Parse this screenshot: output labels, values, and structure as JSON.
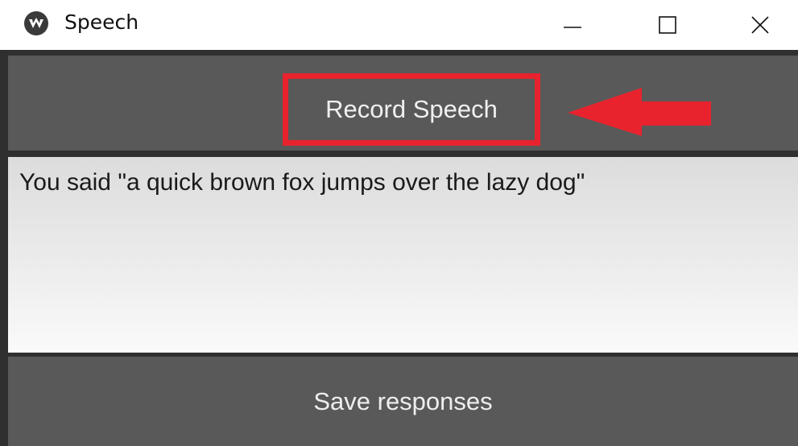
{
  "window": {
    "title": "Speech",
    "icon": "kivy-app-icon",
    "controls": {
      "minimize": "minimize-icon",
      "maximize": "maximize-icon",
      "close": "close-icon"
    }
  },
  "main": {
    "record_button_label": "Record Speech",
    "output_text": "You said \"a quick brown fox jumps over the lazy dog\"",
    "save_button_label": "Save responses"
  },
  "annotation": {
    "highlight_color": "#e8232d",
    "arrow_icon": "left-arrow-icon"
  },
  "colors": {
    "button_background": "#595959",
    "app_background": "#2f2f2f",
    "button_text": "#f0f0f0"
  }
}
